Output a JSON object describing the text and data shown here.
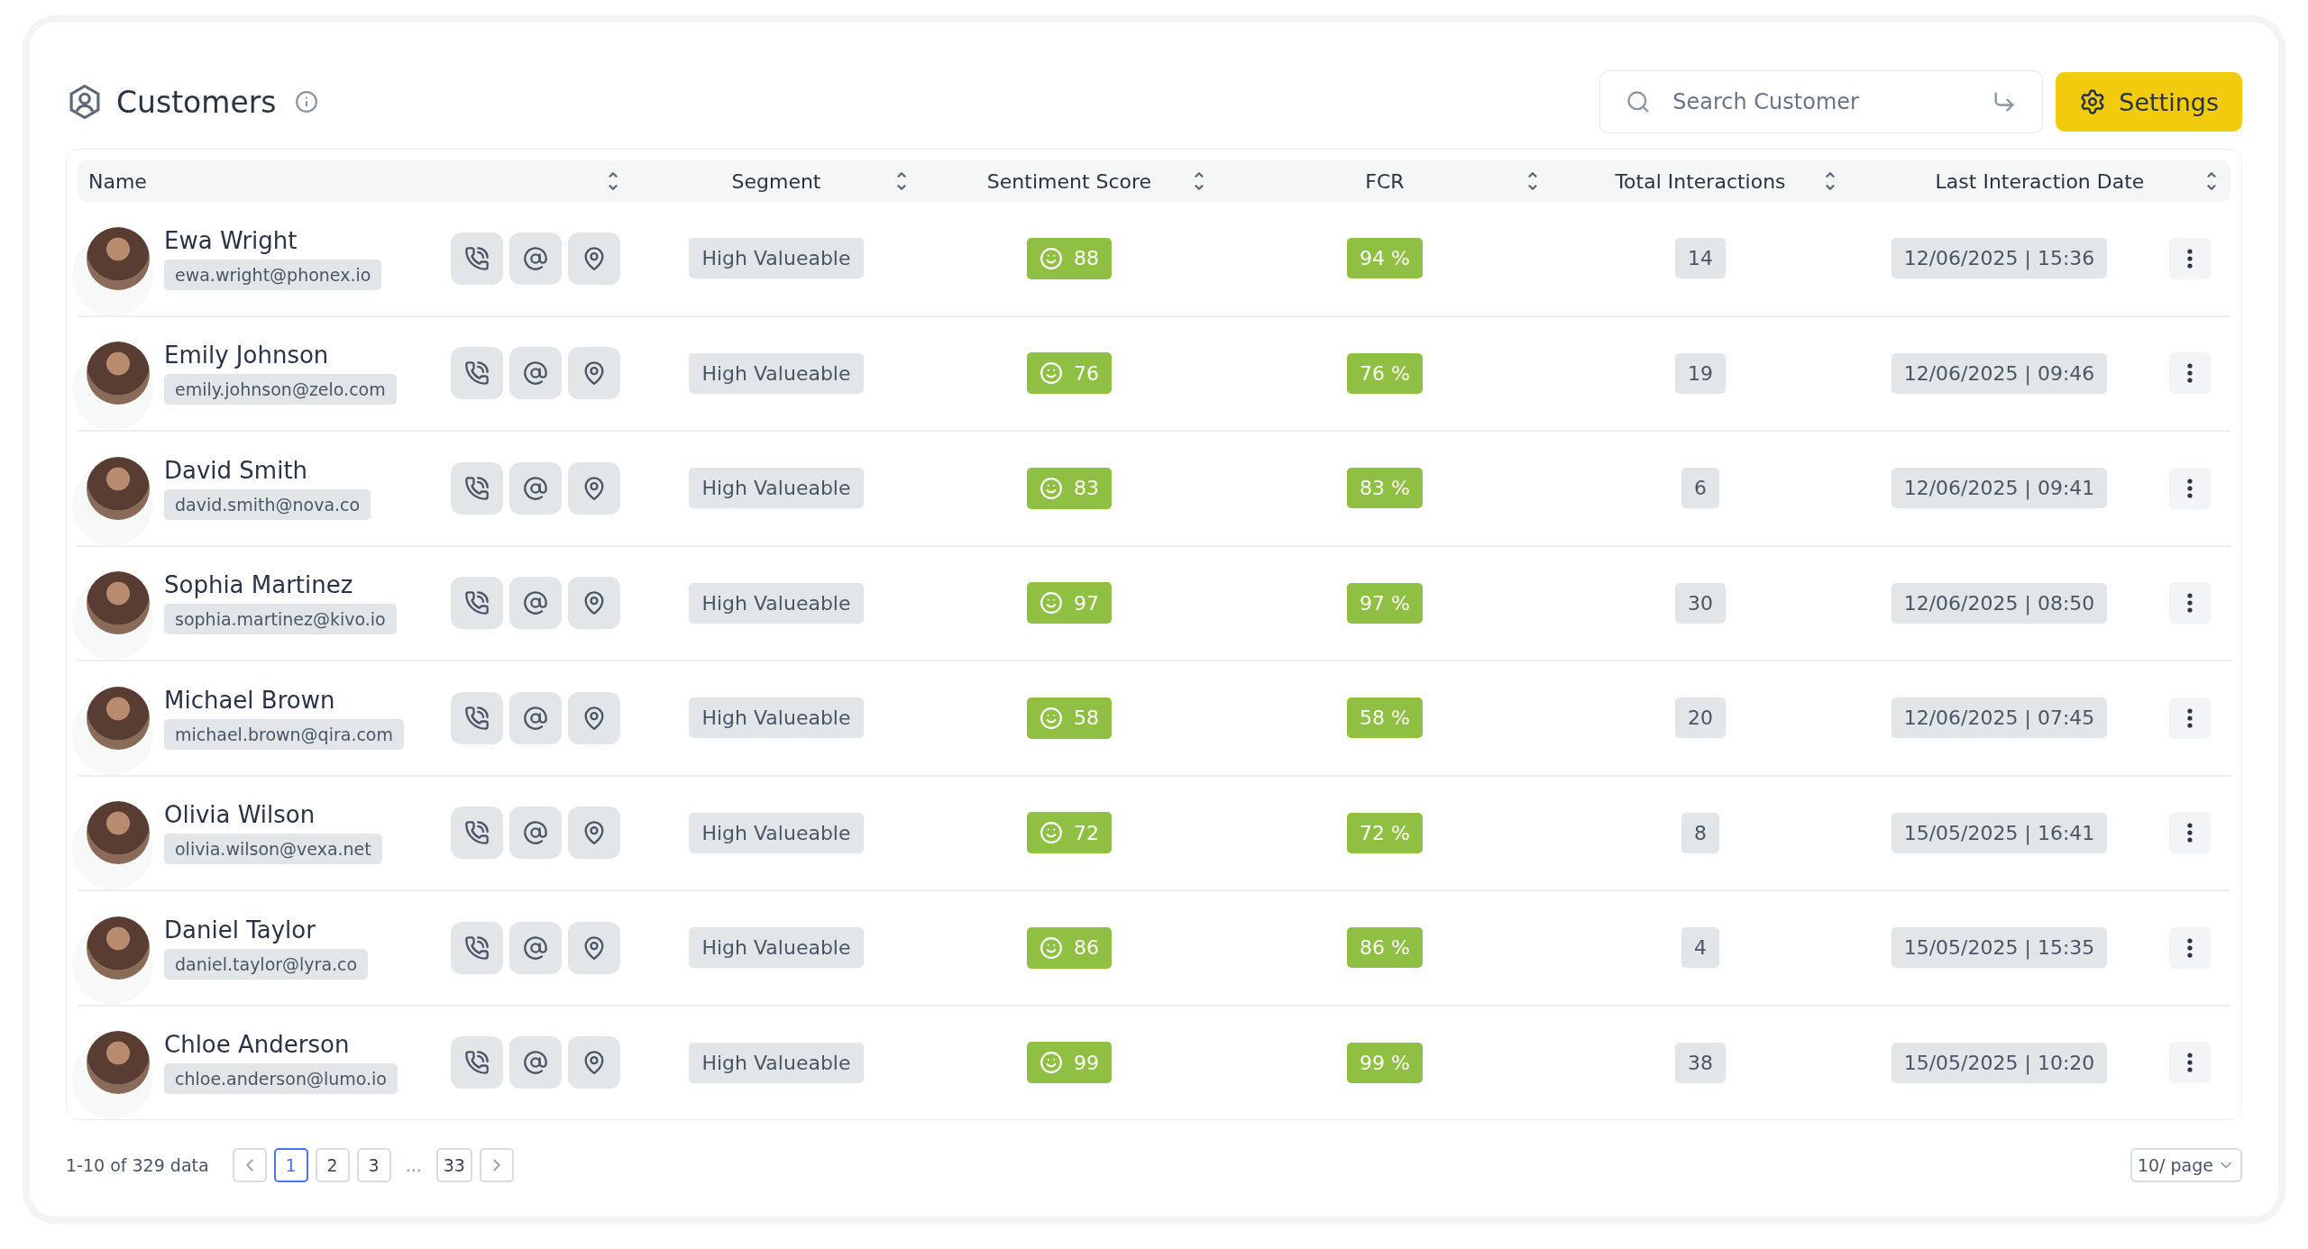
{
  "title": "Customers",
  "search": {
    "placeholder": "Search Customer"
  },
  "settings_button": "Settings",
  "table": {
    "columns": [
      "Name",
      "Segment",
      "Sentiment Score",
      "FCR",
      "Total Interactions",
      "Last Interaction Date"
    ],
    "rows": [
      {
        "name": "Ewa Wright",
        "email": "ewa.wright@phonex.io",
        "segment": "High Valueable",
        "sentiment": "88",
        "fcr": "94 %",
        "interactions": "14",
        "last": "12/06/2025 | 15:36"
      },
      {
        "name": "Emily Johnson",
        "email": "emily.johnson@zelo.com",
        "segment": "High Valueable",
        "sentiment": "76",
        "fcr": "76 %",
        "interactions": "19",
        "last": "12/06/2025 | 09:46"
      },
      {
        "name": "David Smith",
        "email": "david.smith@nova.co",
        "segment": "High Valueable",
        "sentiment": "83",
        "fcr": "83 %",
        "interactions": "6",
        "last": "12/06/2025 | 09:41"
      },
      {
        "name": "Sophia Martinez",
        "email": "sophia.martinez@kivo.io",
        "segment": "High Valueable",
        "sentiment": "97",
        "fcr": "97 %",
        "interactions": "30",
        "last": "12/06/2025 | 08:50"
      },
      {
        "name": "Michael Brown",
        "email": "michael.brown@qira.com",
        "segment": "High Valueable",
        "sentiment": "58",
        "fcr": "58 %",
        "interactions": "20",
        "last": "12/06/2025 | 07:45"
      },
      {
        "name": "Olivia Wilson",
        "email": "olivia.wilson@vexa.net",
        "segment": "High Valueable",
        "sentiment": "72",
        "fcr": "72 %",
        "interactions": "8",
        "last": "15/05/2025 | 16:41"
      },
      {
        "name": "Daniel Taylor",
        "email": "daniel.taylor@lyra.co",
        "segment": "High Valueable",
        "sentiment": "86",
        "fcr": "86 %",
        "interactions": "4",
        "last": "15/05/2025 | 15:35"
      },
      {
        "name": "Chloe Anderson",
        "email": "chloe.anderson@lumo.io",
        "segment": "High Valueable",
        "sentiment": "99",
        "fcr": "99 %",
        "interactions": "38",
        "last": "15/05/2025 | 10:20"
      }
    ]
  },
  "pagination": {
    "summary": "1-10 of 329 data",
    "pages": [
      {
        "label": "1",
        "selected": true
      },
      {
        "label": "2",
        "selected": false
      },
      {
        "label": "3",
        "selected": false
      },
      {
        "label": "...",
        "kind": "ellipsis"
      },
      {
        "label": "33",
        "selected": false
      }
    ],
    "page_size": "10/ page"
  }
}
